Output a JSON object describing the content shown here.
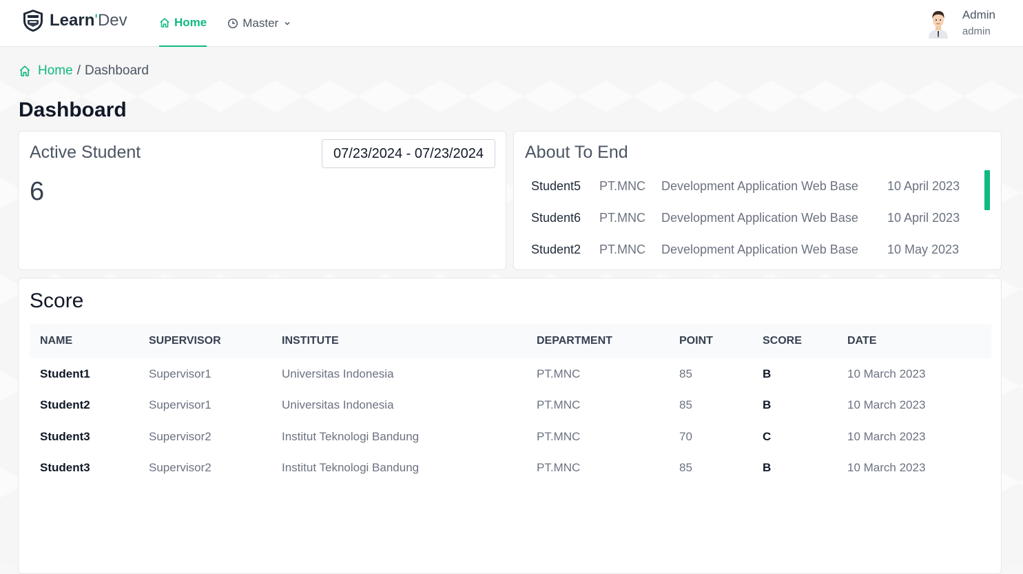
{
  "brand": {
    "bold": "Learn",
    "apostrophe": "'",
    "light": "Dev"
  },
  "nav": {
    "home": "Home",
    "master": "Master"
  },
  "user": {
    "name": "Admin",
    "role": "admin"
  },
  "breadcrumb": {
    "home": "Home",
    "separator": "/",
    "current": "Dashboard"
  },
  "page_title": "Dashboard",
  "active_student": {
    "title": "Active Student",
    "date_range": "07/23/2024 - 07/23/2024",
    "count": "6"
  },
  "about_to_end": {
    "title": "About To End",
    "rows": [
      {
        "name": "Student5",
        "institute": "PT.MNC",
        "department": "Development Application Web Base",
        "date": "10 April 2023"
      },
      {
        "name": "Student6",
        "institute": "PT.MNC",
        "department": "Development Application Web Base",
        "date": "10 April 2023"
      },
      {
        "name": "Student2",
        "institute": "PT.MNC",
        "department": "Development Application Web Base",
        "date": "10 May 2023"
      }
    ]
  },
  "score": {
    "title": "Score",
    "headers": [
      "NAME",
      "SUPERVISOR",
      "INSTITUTE",
      "DEPARTMENT",
      "POINT",
      "SCORE",
      "DATE"
    ],
    "rows": [
      [
        "Student1",
        "Supervisor1",
        "Universitas Indonesia",
        "PT.MNC",
        "85",
        "B",
        "10 March 2023"
      ],
      [
        "Student2",
        "Supervisor1",
        "Universitas Indonesia",
        "PT.MNC",
        "85",
        "B",
        "10 March 2023"
      ],
      [
        "Student3",
        "Supervisor2",
        "Institut Teknologi Bandung",
        "PT.MNC",
        "70",
        "C",
        "10 March 2023"
      ],
      [
        "Student3",
        "Supervisor2",
        "Institut Teknologi Bandung",
        "PT.MNC",
        "85",
        "B",
        "10 March 2023"
      ]
    ]
  },
  "colors": {
    "accent": "#10b981",
    "text": "#1f2937",
    "muted": "#6b7280"
  },
  "icons": {
    "brand": "shield-logo-icon",
    "home": "home-icon",
    "master": "clock-icon",
    "dropdown": "chevron-down-icon",
    "avatar": "user-avatar"
  }
}
